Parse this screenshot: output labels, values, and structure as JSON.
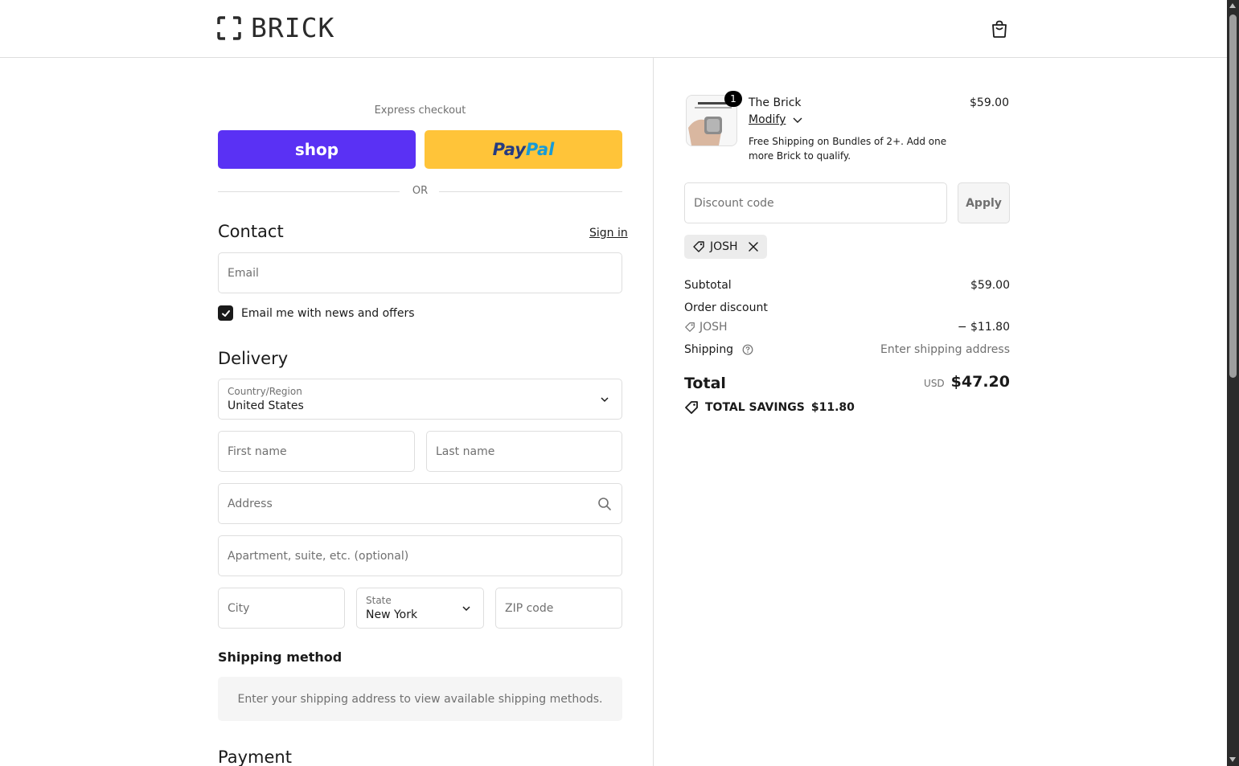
{
  "header": {
    "brand": "BRICK",
    "logo_icon": "brick-frame-logo",
    "cart_icon": "shopping-bag-icon"
  },
  "express": {
    "label": "Express checkout",
    "shop_label": "shop",
    "paypal_label_a": "Pay",
    "paypal_label_b": "Pal",
    "divider_text": "OR"
  },
  "contact": {
    "title": "Contact",
    "sign_in": "Sign in",
    "email_placeholder": "Email",
    "newsletter_label": "Email me with news and offers",
    "newsletter_checked": true
  },
  "delivery": {
    "title": "Delivery",
    "country_label": "Country/Region",
    "country_value": "United States",
    "first_name_placeholder": "First name",
    "last_name_placeholder": "Last name",
    "address_placeholder": "Address",
    "apartment_placeholder": "Apartment, suite, etc. (optional)",
    "city_placeholder": "City",
    "state_label": "State",
    "state_value": "New York",
    "zip_placeholder": "ZIP code"
  },
  "shipping_method": {
    "title": "Shipping method",
    "message": "Enter your shipping address to view available shipping methods."
  },
  "payment": {
    "title": "Payment"
  },
  "order": {
    "item": {
      "quantity": "1",
      "name": "The Brick",
      "modify": "Modify",
      "note": "Free Shipping on Bundles of 2+. Add one more Brick to qualify.",
      "price": "$59.00"
    },
    "discount_placeholder": "Discount code",
    "apply_label": "Apply",
    "applied_code": "JOSH",
    "subtotal_label": "Subtotal",
    "subtotal_value": "$59.00",
    "order_discount_label": "Order discount",
    "discount_code": "JOSH",
    "discount_value": "− $11.80",
    "shipping_label": "Shipping",
    "shipping_value": "Enter shipping address",
    "total_label": "Total",
    "total_currency": "USD",
    "total_value": "$47.20",
    "savings_label": "TOTAL SAVINGS",
    "savings_value": "$11.80"
  },
  "colors": {
    "shop_pay": "#5a31f4",
    "paypal": "#ffc439",
    "text": "#1a1a1a",
    "muted": "#707070",
    "border": "#dedede"
  }
}
